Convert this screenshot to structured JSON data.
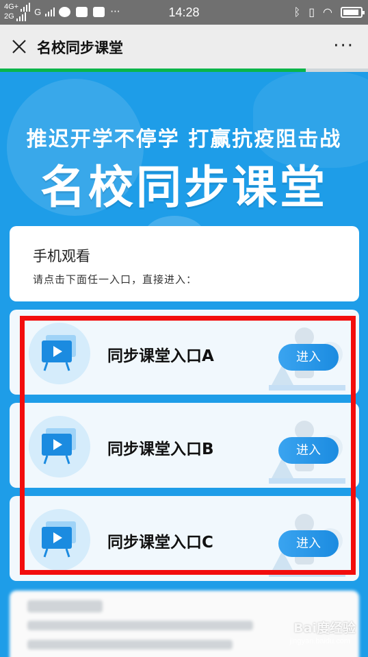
{
  "status_bar": {
    "network_top": "4G+",
    "network_bottom": "2G",
    "carrier_g": "G",
    "more": "···",
    "time": "14:28"
  },
  "nav": {
    "title": "名校同步课堂",
    "more": "···"
  },
  "page": {
    "load_progress": 0.83
  },
  "hero": {
    "subtitle": "推迟开学不停学 打赢抗疫阻击战",
    "title": "名校同步课堂"
  },
  "info": {
    "title": "手机观看",
    "text": "请点击下面任一入口，直接进入："
  },
  "entries": [
    {
      "label": "同步课堂入口A",
      "button": "进入"
    },
    {
      "label": "同步课堂入口B",
      "button": "进入"
    },
    {
      "label": "同步课堂入口C",
      "button": "进入"
    }
  ],
  "watermark": {
    "text": "Bai度经验",
    "url": "jingyan.baidu.com"
  },
  "colors": {
    "page_background": "#1e9de8",
    "highlight_box": "#f20d0d",
    "enter_button": "#2196e8",
    "progress": "#0ab54a"
  }
}
